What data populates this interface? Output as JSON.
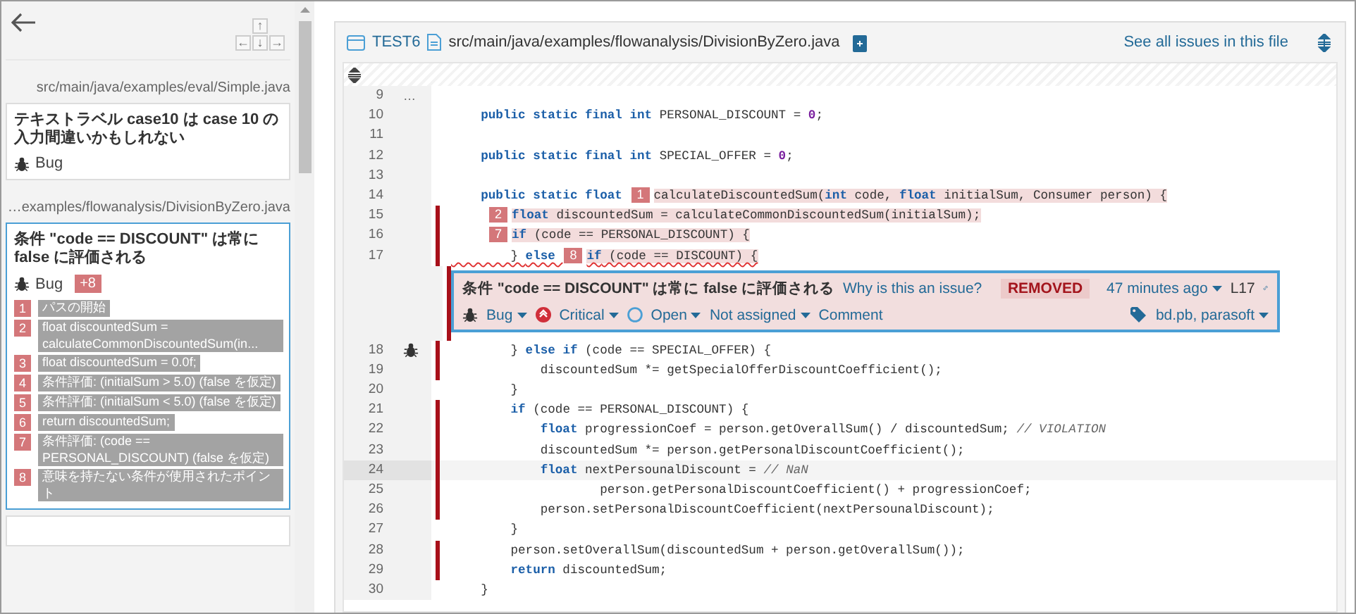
{
  "sidebar": {
    "keys": [
      "↑",
      "←",
      "↓",
      "→"
    ],
    "groups": [
      {
        "path": "src/main/java/examples/eval/Simple.java",
        "issues": [
          {
            "title": "テキストラベル case10 は case 10 の入力間違いかもしれない",
            "type": "Bug",
            "selected": false
          }
        ]
      },
      {
        "path": "…examples/flowanalysis/DivisionByZero.java",
        "issues": [
          {
            "title": "条件 \"code == DISCOUNT\" は常に false に評価される",
            "type": "Bug",
            "selected": true,
            "badge": "+8",
            "flows": [
              {
                "number": "1",
                "text": "パスの開始"
              },
              {
                "number": "2",
                "text": "float discountedSum = calculateCommonDiscountedSum(in..."
              },
              {
                "number": "3",
                "text": "float discountedSum = 0.0f;"
              },
              {
                "number": "4",
                "text": "条件評価: (initialSum > 5.0) (false を仮定)"
              },
              {
                "number": "5",
                "text": "条件評価: (initialSum < 5.0) (false を仮定)"
              },
              {
                "number": "6",
                "text": "return discountedSum;"
              },
              {
                "number": "7",
                "text": "条件評価: (code == PERSONAL_DISCOUNT) (false を仮定)"
              },
              {
                "number": "8",
                "text": "意味を持たない条件が使用されたポイント"
              }
            ]
          }
        ]
      }
    ]
  },
  "viewer": {
    "project": "TEST6",
    "file": "src/main/java/examples/flowanalysis/DivisionByZero.java",
    "all_issues_link": "See all issues in this file",
    "lines": [
      {
        "number": "9",
        "gutter": "…",
        "changed": false,
        "selected": false,
        "bug_marker": false
      },
      {
        "number": "10",
        "changed": false,
        "selected": false,
        "bug_marker": false,
        "segments": [
          {
            "kind": "kw",
            "text": "    public static final int"
          },
          {
            "kind": "plain",
            "text": " PERSONAL_DISCOUNT = "
          },
          {
            "kind": "num",
            "text": "0"
          },
          {
            "kind": "plain",
            "text": ";"
          }
        ]
      },
      {
        "number": "11",
        "changed": false,
        "selected": false,
        "bug_marker": false
      },
      {
        "number": "12",
        "changed": false,
        "selected": false,
        "bug_marker": false,
        "segments": [
          {
            "kind": "kw",
            "text": "    public static final int"
          },
          {
            "kind": "plain",
            "text": " SPECIAL_OFFER = "
          },
          {
            "kind": "num",
            "text": "0"
          },
          {
            "kind": "plain",
            "text": ";"
          }
        ]
      },
      {
        "number": "13",
        "changed": false,
        "selected": false,
        "bug_marker": false
      },
      {
        "number": "14",
        "changed": false,
        "selected": false,
        "bug_marker": false,
        "segments": [
          {
            "kind": "kw",
            "text": "    public static float ",
            "highlight": false
          },
          {
            "kind": "step",
            "text": "1"
          },
          {
            "kind": "plain",
            "text": "calculateDiscountedSum(",
            "highlight": true
          },
          {
            "kind": "kw",
            "text": "int",
            "highlight": true
          },
          {
            "kind": "plain",
            "text": " code, ",
            "highlight": true
          },
          {
            "kind": "kw",
            "text": "float",
            "highlight": true
          },
          {
            "kind": "plain",
            "text": " initialSum, Consumer person) {",
            "highlight": true
          }
        ]
      },
      {
        "number": "15",
        "changed": true,
        "selected": false,
        "bug_marker": false,
        "segments": [
          {
            "kind": "step",
            "text": "2"
          },
          {
            "kind": "kw",
            "text": "float",
            "highlight": true
          },
          {
            "kind": "plain",
            "text": " discountedSum = calculateCommonDiscountedSum(initialSum);",
            "highlight": true
          }
        ]
      },
      {
        "number": "16",
        "changed": true,
        "selected": false,
        "bug_marker": false,
        "segments": [
          {
            "kind": "step",
            "text": "7"
          },
          {
            "kind": "kw",
            "text": "if",
            "highlight": true
          },
          {
            "kind": "plain",
            "text": " (code == PERSONAL_DISCOUNT) {",
            "highlight": true
          }
        ]
      },
      {
        "number": "17",
        "changed": true,
        "selected": false,
        "bug_marker": false,
        "segments": [
          {
            "kind": "plain",
            "text": "        } ",
            "squiggle": true,
            "highlight": false
          },
          {
            "kind": "kw",
            "text": "else ",
            "squiggle": true,
            "highlight": false
          },
          {
            "kind": "step",
            "text": "8"
          },
          {
            "kind": "kw",
            "text": "if",
            "squiggle": true,
            "highlight": true
          },
          {
            "kind": "plain",
            "text": " (code == DISCOUNT) {",
            "squiggle": true,
            "highlight": true
          }
        ],
        "issue_panel": {
          "title": "条件 \"code == DISCOUNT\" は常に false に評価される",
          "why": "Why is this an issue?",
          "status_badge": "REMOVED",
          "age": "47 minutes ago",
          "line": "L17",
          "type": "Bug",
          "severity": "Critical",
          "status": "Open",
          "assignee": "Not assigned",
          "comment": "Comment",
          "tags": "bd.pb, parasoft"
        }
      },
      {
        "number": "18",
        "changed": true,
        "selected": false,
        "bug_marker": true,
        "segments": [
          {
            "kind": "plain",
            "text": "        } "
          },
          {
            "kind": "kw",
            "text": "else if"
          },
          {
            "kind": "plain",
            "text": " (code == SPECIAL_OFFER) {"
          }
        ]
      },
      {
        "number": "19",
        "changed": true,
        "selected": false,
        "bug_marker": false,
        "segments": [
          {
            "kind": "plain",
            "text": "            discountedSum *= getSpecialOfferDiscountCoefficient();"
          }
        ]
      },
      {
        "number": "20",
        "changed": false,
        "selected": false,
        "bug_marker": false,
        "segments": [
          {
            "kind": "plain",
            "text": "        }"
          }
        ]
      },
      {
        "number": "21",
        "changed": true,
        "selected": false,
        "bug_marker": false,
        "segments": [
          {
            "kind": "kw",
            "text": "        if"
          },
          {
            "kind": "plain",
            "text": " (code == PERSONAL_DISCOUNT) {"
          }
        ]
      },
      {
        "number": "22",
        "changed": true,
        "selected": false,
        "bug_marker": false,
        "segments": [
          {
            "kind": "kw",
            "text": "            float"
          },
          {
            "kind": "plain",
            "text": " progressionCoef = person.getOverallSum() / discountedSum; "
          },
          {
            "kind": "comment",
            "text": "// VIOLATION"
          }
        ]
      },
      {
        "number": "23",
        "changed": true,
        "selected": false,
        "bug_marker": false,
        "segments": [
          {
            "kind": "plain",
            "text": "            discountedSum *= person.getPersonalDiscountCoefficient();"
          }
        ]
      },
      {
        "number": "24",
        "changed": true,
        "selected": true,
        "bug_marker": false,
        "segments": [
          {
            "kind": "kw",
            "text": "            float"
          },
          {
            "kind": "plain",
            "text": " nextPersounalDiscount = "
          },
          {
            "kind": "comment",
            "text": "// NaN"
          }
        ]
      },
      {
        "number": "25",
        "changed": true,
        "selected": false,
        "bug_marker": false,
        "segments": [
          {
            "kind": "plain",
            "text": "                    person.getPersonalDiscountCoefficient() + progressionCoef;"
          }
        ]
      },
      {
        "number": "26",
        "changed": true,
        "selected": false,
        "bug_marker": false,
        "segments": [
          {
            "kind": "plain",
            "text": "            person.setPersonalDiscountCoefficient(nextPersounalDiscount);"
          }
        ]
      },
      {
        "number": "27",
        "changed": false,
        "selected": false,
        "bug_marker": false,
        "segments": [
          {
            "kind": "plain",
            "text": "        }"
          }
        ]
      },
      {
        "number": "28",
        "changed": true,
        "selected": false,
        "bug_marker": false,
        "segments": [
          {
            "kind": "plain",
            "text": "        person.setOverallSum(discountedSum + person.getOverallSum());"
          }
        ]
      },
      {
        "number": "29",
        "changed": true,
        "selected": false,
        "bug_marker": false,
        "segments": [
          {
            "kind": "kw",
            "text": "        return"
          },
          {
            "kind": "plain",
            "text": " discountedSum;"
          }
        ]
      },
      {
        "number": "30",
        "changed": false,
        "selected": false,
        "bug_marker": false,
        "segments": [
          {
            "kind": "plain",
            "text": "    }"
          }
        ]
      }
    ]
  }
}
